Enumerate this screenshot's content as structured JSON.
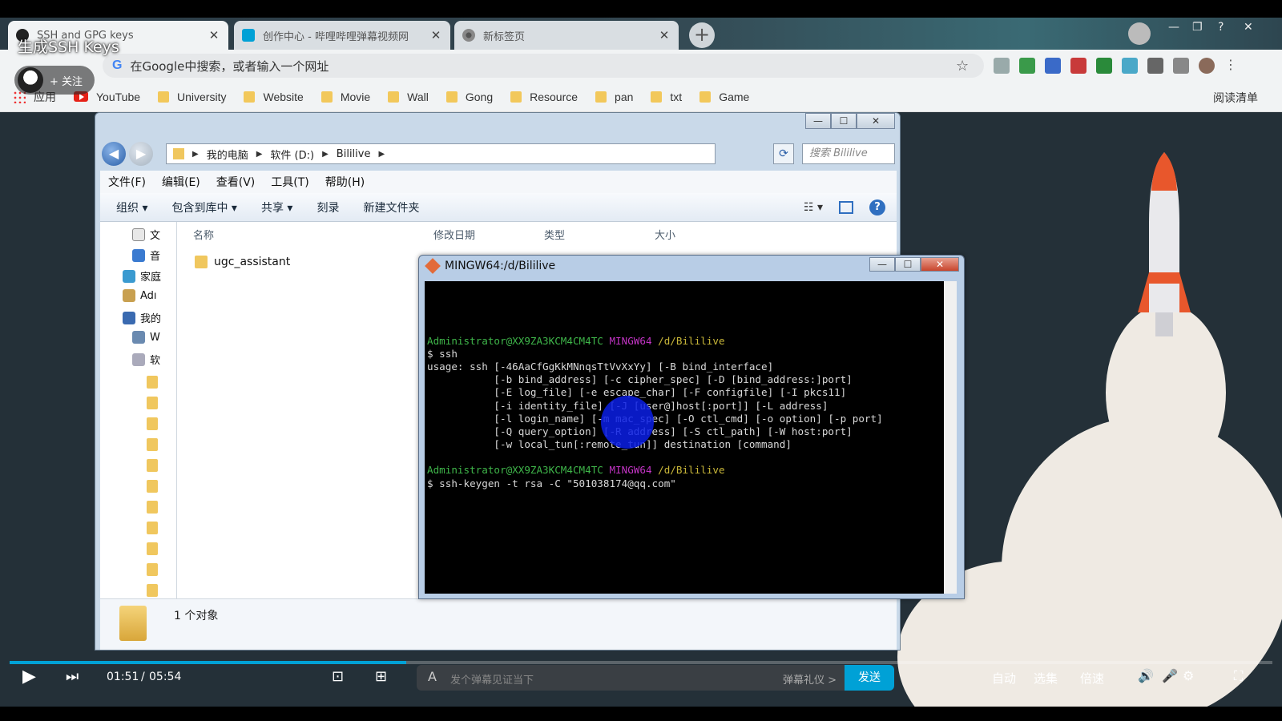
{
  "video": {
    "title": "生成SSH Keys"
  },
  "uploader": {
    "follow_label": "+ 关注"
  },
  "browser": {
    "tabs": [
      {
        "label": "SSH and GPG keys"
      },
      {
        "label": "创作中心 - 哔哩哔哩弹幕视频网"
      },
      {
        "label": "新标签页"
      }
    ],
    "omnibox_text": "在Google中搜索，或者输入一个网址",
    "bookmarks": [
      "应用",
      "YouTube",
      "University",
      "Website",
      "Movie",
      "Wall",
      "Gong",
      "Resource",
      "pan",
      "txt",
      "Game"
    ],
    "reading_list": "阅读清单"
  },
  "explorer": {
    "breadcrumbs": [
      "我的电脑",
      "软件 (D:)",
      "Bililive"
    ],
    "search_placeholder": "搜索 Bililive",
    "menu": [
      "文件(F)",
      "编辑(E)",
      "查看(V)",
      "工具(T)",
      "帮助(H)"
    ],
    "commands": [
      "组织 ▾",
      "包含到库中 ▾",
      "共享 ▾",
      "刻录",
      "新建文件夹"
    ],
    "nav_items": [
      "文",
      "音",
      "家庭",
      "Adı",
      "我的",
      "W",
      "软"
    ],
    "columns": [
      "名称",
      "修改日期",
      "类型",
      "大小"
    ],
    "files": [
      "ugc_assistant"
    ],
    "status": "1 个对象"
  },
  "terminal": {
    "title": "MINGW64:/d/Bililive",
    "lines": [
      {
        "user": "Administrator@XX9ZA3KCM4CM4TC",
        "env": "MINGW64",
        "path": "/d/Bililive"
      },
      {
        "text": "$ ssh"
      },
      {
        "text": "usage: ssh [-46AaCfGgKkMNnqsTtVvXxYy] [-B bind_interface]"
      },
      {
        "text": "           [-b bind_address] [-c cipher_spec] [-D [bind_address:]port]"
      },
      {
        "text": "           [-E log_file] [-e escape_char] [-F configfile] [-I pkcs11]"
      },
      {
        "text": "           [-i identity_file] [-J [user@]host[:port]] [-L address]"
      },
      {
        "text": "           [-l login_name] [-m mac_spec] [-O ctl_cmd] [-o option] [-p port]"
      },
      {
        "text": "           [-Q query_option] [-R address] [-S ctl_path] [-W host:port]"
      },
      {
        "text": "           [-w local_tun[:remote_tun]] destination [command]"
      },
      {
        "text": ""
      },
      {
        "user": "Administrator@XX9ZA3KCM4CM4TC",
        "env": "MINGW64",
        "path": "/d/Bililive"
      },
      {
        "text": "$ ssh-keygen -t rsa -C \"501038174@qq.com\""
      }
    ]
  },
  "player": {
    "current_time": "01:51",
    "separator": "/",
    "duration": "05:54",
    "progress": 0.314,
    "danmaku_placeholder": "发个弹幕见证当下",
    "danmaku_gift": "弹幕礼仪 >",
    "send_label": "发送",
    "auto_label": "自动",
    "episodes_label": "选集",
    "speed_label": "倍速"
  },
  "colors": {
    "accent": "#00a1d6",
    "prompt_user": "#3fb64a",
    "prompt_env": "#c234c4",
    "prompt_path": "#c9b739"
  }
}
